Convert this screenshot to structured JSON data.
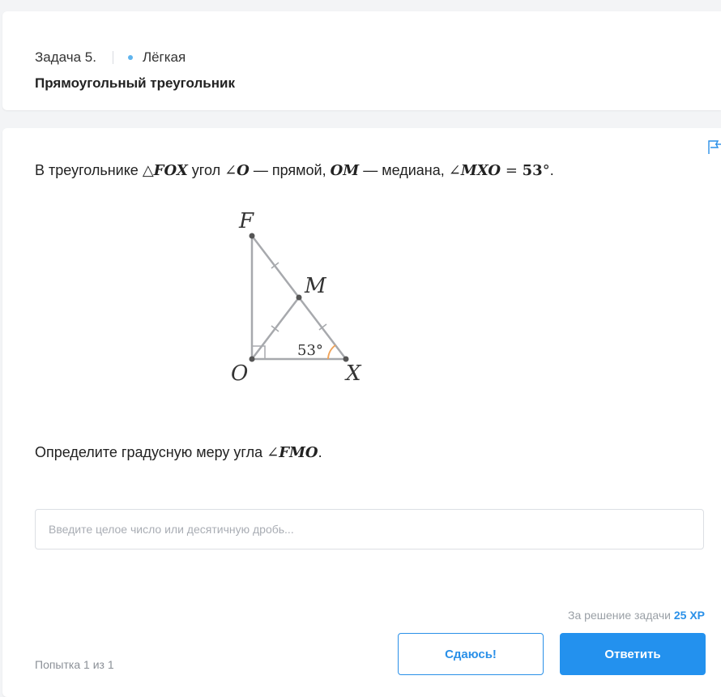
{
  "header": {
    "task_number": "Задача 5.",
    "difficulty": "Лёгкая",
    "difficulty_color": "#5fb4ee",
    "title": "Прямоугольный треугольник"
  },
  "problem": {
    "intro": "В треугольнике ",
    "triangle": "△",
    "triangle_name": "FOX",
    "t1": " угол ",
    "angle_sym": "∠",
    "angle_o": "O",
    "t2": " — прямой, ",
    "median": "OM",
    "t3": " — медиана, ",
    "angle_sym2": "∠",
    "angle_mxo": "MXO",
    "eq": " = ",
    "value": "53",
    "deg": "°",
    "end": "."
  },
  "figure": {
    "label_f": "F",
    "label_m": "M",
    "label_o": "O",
    "label_x": "X",
    "angle_label": "53°",
    "line_color": "#a7a9ad",
    "arc_color": "#f0a45a"
  },
  "question": {
    "text": "Определите градусную меру угла ",
    "angle_sym": "∠",
    "angle": "FMO",
    "end": "."
  },
  "answer": {
    "placeholder": "Введите целое число или десятичную дробь..."
  },
  "reward": {
    "text": "За решение задачи ",
    "xp": "25 XP"
  },
  "attempt": "Попытка 1 из 1",
  "buttons": {
    "give_up": "Сдаюсь!",
    "submit": "Ответить"
  },
  "colors": {
    "accent": "#2391ee"
  }
}
